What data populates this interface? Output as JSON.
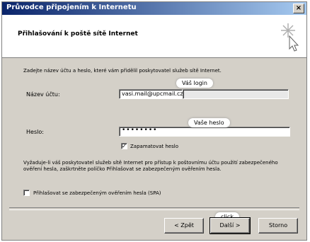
{
  "window": {
    "title": "Průvodce připojením k Internetu",
    "close_glyph": "×"
  },
  "header": {
    "heading": "Přihlašování k poště sítě Internet",
    "icon": "wizard-sparkle-icon"
  },
  "content": {
    "intro": "Zadejte název účtu a heslo, které vám přidělil poskytovatel služeb sítě Internet.",
    "account_label": "Název účtu:",
    "account_value": "vasi.mail@upcmail.cz",
    "password_label": "Heslo:",
    "password_mask": "••••••••",
    "remember_label": "Zapamatovat heslo",
    "remember_checked": "✓",
    "spa_description": "Vyžaduje-li váš poskytovatel služeb sítě Internet pro přístup k poštovnímu účtu použití zabezpečeného ověření hesla, zaškrtněte políčko Přihlašovat se zabezpečeným ověřením hesla.",
    "spa_label": "Přihlašovat se zabezpečeným ověřením hesla (SPA)"
  },
  "callouts": {
    "login": "Váš login",
    "password": "Vaše heslo",
    "click": "click"
  },
  "buttons": {
    "back": "< Zpět",
    "next": "Další >",
    "cancel": "Storno"
  }
}
